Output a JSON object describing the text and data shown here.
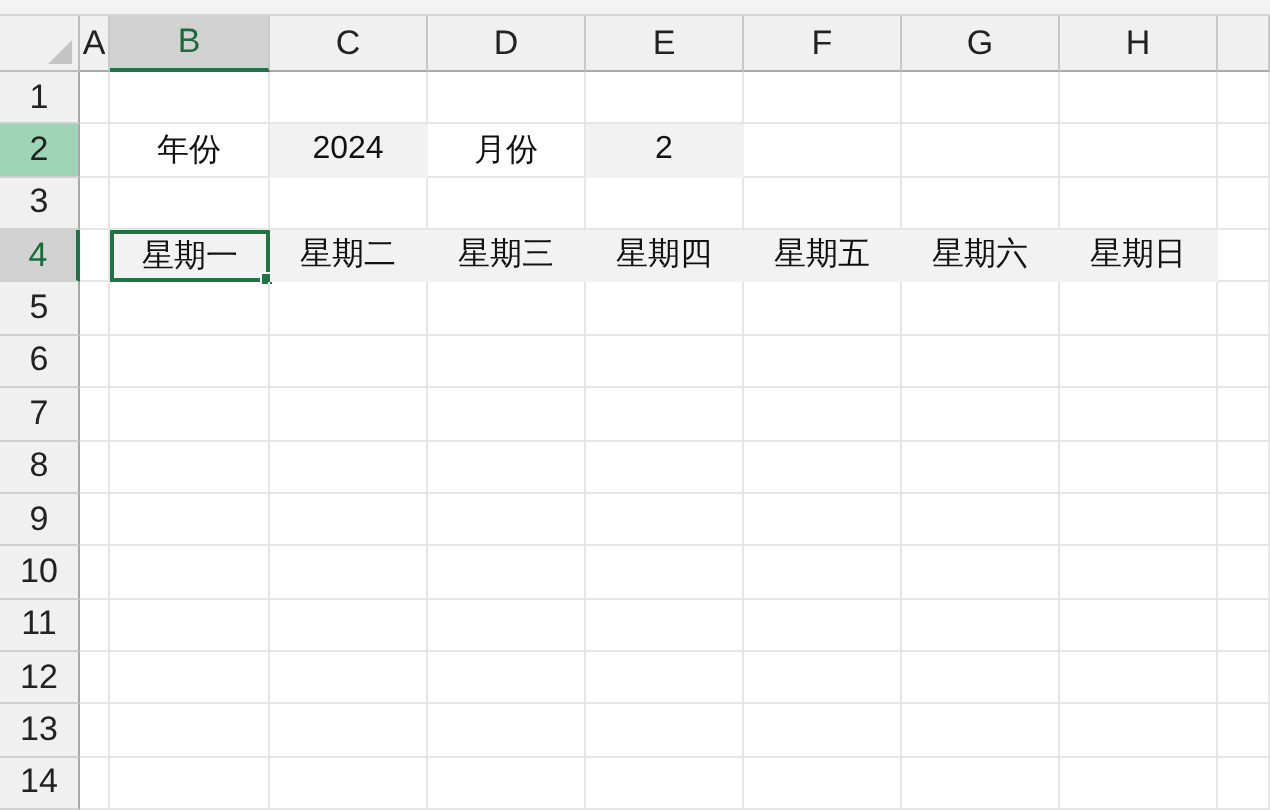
{
  "columns": [
    {
      "label": "A",
      "selected": false
    },
    {
      "label": "B",
      "selected": true
    },
    {
      "label": "C",
      "selected": false
    },
    {
      "label": "D",
      "selected": false
    },
    {
      "label": "E",
      "selected": false
    },
    {
      "label": "F",
      "selected": false
    },
    {
      "label": "G",
      "selected": false
    },
    {
      "label": "H",
      "selected": false
    }
  ],
  "rows": [
    {
      "label": "1",
      "selected": false,
      "highlighted": false
    },
    {
      "label": "2",
      "selected": false,
      "highlighted": true,
      "cells": [
        {
          "text": "年份",
          "shaded": false,
          "active": false
        },
        {
          "text": "2024",
          "shaded": true,
          "active": false
        },
        {
          "text": "月份",
          "shaded": false,
          "active": false
        },
        {
          "text": "2",
          "shaded": true,
          "active": false
        }
      ]
    },
    {
      "label": "3",
      "selected": false,
      "highlighted": false
    },
    {
      "label": "4",
      "selected": true,
      "highlighted": false,
      "cells": [
        {
          "text": "星期一",
          "shaded": true,
          "active": true
        },
        {
          "text": "星期二",
          "shaded": true,
          "active": false
        },
        {
          "text": "星期三",
          "shaded": true,
          "active": false
        },
        {
          "text": "星期四",
          "shaded": true,
          "active": false
        },
        {
          "text": "星期五",
          "shaded": true,
          "active": false
        },
        {
          "text": "星期六",
          "shaded": true,
          "active": false
        },
        {
          "text": "星期日",
          "shaded": true,
          "active": false
        }
      ]
    },
    {
      "label": "5",
      "selected": false,
      "highlighted": false
    },
    {
      "label": "6",
      "selected": false,
      "highlighted": false
    },
    {
      "label": "7",
      "selected": false,
      "highlighted": false
    },
    {
      "label": "8",
      "selected": false,
      "highlighted": false
    },
    {
      "label": "9",
      "selected": false,
      "highlighted": false
    },
    {
      "label": "10",
      "selected": false,
      "highlighted": false
    },
    {
      "label": "11",
      "selected": false,
      "highlighted": false
    },
    {
      "label": "12",
      "selected": false,
      "highlighted": false
    },
    {
      "label": "13",
      "selected": false,
      "highlighted": false
    },
    {
      "label": "14",
      "selected": false,
      "highlighted": false
    }
  ]
}
